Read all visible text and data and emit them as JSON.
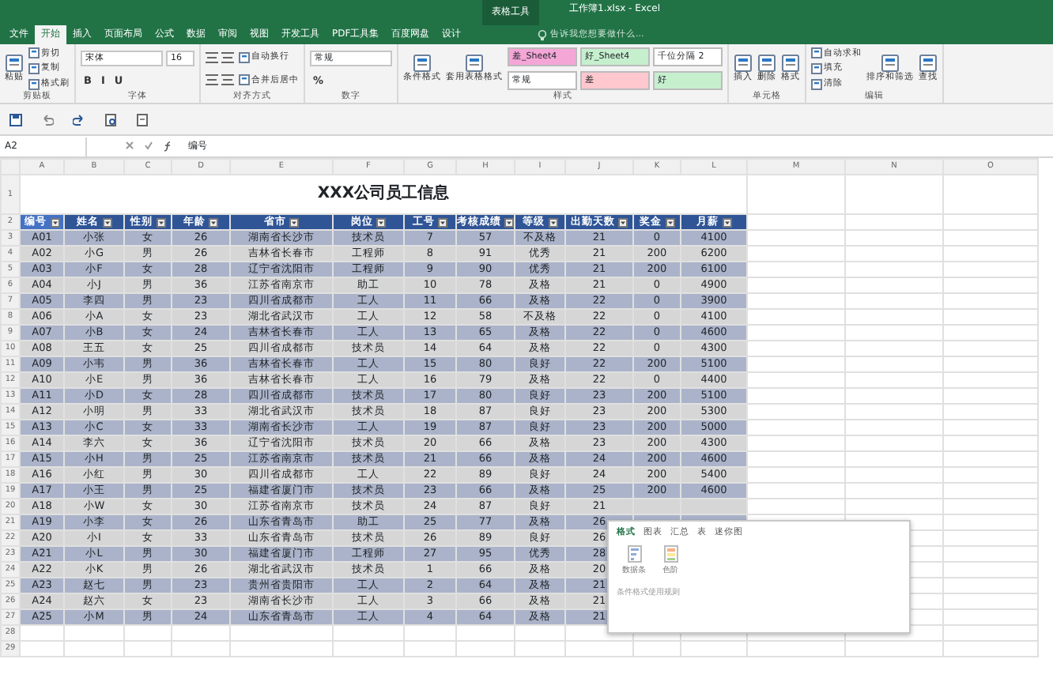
{
  "window": {
    "title": "工作簿1.xlsx - Excel",
    "context_label": "表格工具",
    "tell_me": "告诉我您想要做什么..."
  },
  "tabs": [
    {
      "label": "文件",
      "selected": false
    },
    {
      "label": "开始",
      "selected": true
    },
    {
      "label": "插入",
      "selected": false
    },
    {
      "label": "页面布局",
      "selected": false
    },
    {
      "label": "公式",
      "selected": false
    },
    {
      "label": "数据",
      "selected": false
    },
    {
      "label": "审阅",
      "selected": false
    },
    {
      "label": "视图",
      "selected": false
    },
    {
      "label": "开发工具",
      "selected": false
    },
    {
      "label": "PDF工具集",
      "selected": false
    },
    {
      "label": "百度网盘",
      "selected": false
    },
    {
      "label": "设计",
      "selected": false
    }
  ],
  "ribbon": {
    "groups": [
      {
        "label": "剪贴板",
        "columns": [
          [
            [
              {
                "kind": "big",
                "label": "粘贴"
              }
            ]
          ],
          [
            [
              {
                "kind": "small",
                "label": "剪切"
              }
            ],
            [
              {
                "kind": "small",
                "label": "复制"
              }
            ],
            [
              {
                "kind": "small",
                "label": "格式刷"
              }
            ]
          ]
        ]
      },
      {
        "label": "字体",
        "columns": [
          [
            [
              {
                "kind": "field",
                "label": "宋体"
              },
              {
                "kind": "field",
                "label": "16"
              }
            ],
            [
              {
                "kind": "glyph",
                "label": "B"
              },
              {
                "kind": "glyph",
                "label": "I"
              },
              {
                "kind": "glyph",
                "label": "U"
              }
            ]
          ]
        ]
      },
      {
        "label": "对齐方式",
        "columns": [
          [
            [
              {
                "kind": "align"
              },
              {
                "kind": "align"
              }
            ],
            [
              {
                "kind": "align"
              },
              {
                "kind": "align"
              }
            ]
          ],
          [
            [
              {
                "kind": "small",
                "label": "自动换行"
              }
            ],
            [
              {
                "kind": "small",
                "label": "合并后居中"
              }
            ]
          ]
        ]
      },
      {
        "label": "数字",
        "columns": [
          [
            [
              {
                "kind": "field",
                "label": "常规"
              }
            ],
            [
              {
                "kind": "glyph",
                "label": "%"
              }
            ]
          ]
        ]
      },
      {
        "label": "样式",
        "columns": [
          [
            [
              {
                "kind": "big",
                "label": "条件格式"
              }
            ]
          ],
          [
            [
              {
                "kind": "big",
                "label": "套用表格格式"
              }
            ]
          ],
          [
            [
              {
                "kind": "style",
                "label": "差_Sheet4",
                "color": "#f4a6d7"
              },
              {
                "kind": "style",
                "label": "好_Sheet4",
                "color": "#c6efce"
              },
              {
                "kind": "style",
                "label": "千位分隔 2",
                "color": "#ffffff"
              }
            ],
            [
              {
                "kind": "style",
                "label": "常规",
                "color": "#ffffff"
              },
              {
                "kind": "style",
                "label": "差",
                "color": "#ffc7ce"
              },
              {
                "kind": "style",
                "label": "好",
                "color": "#c6efce"
              }
            ]
          ]
        ]
      },
      {
        "label": "单元格",
        "columns": [
          [
            [
              {
                "kind": "big",
                "label": "插入"
              }
            ]
          ],
          [
            [
              {
                "kind": "big",
                "label": "删除"
              }
            ]
          ],
          [
            [
              {
                "kind": "big",
                "label": "格式"
              }
            ]
          ]
        ]
      },
      {
        "label": "编辑",
        "columns": [
          [
            [
              {
                "kind": "small",
                "label": "自动求和"
              }
            ],
            [
              {
                "kind": "small",
                "label": "填充"
              }
            ],
            [
              {
                "kind": "small",
                "label": "清除"
              }
            ]
          ],
          [
            [
              {
                "kind": "big",
                "label": "排序和筛选"
              }
            ]
          ],
          [
            [
              {
                "kind": "big",
                "label": "查找"
              }
            ]
          ]
        ]
      }
    ]
  },
  "formula_bar": {
    "name_box": "A2",
    "formula": "编号"
  },
  "sheet": {
    "row_numbers": [
      "1",
      "2",
      "3",
      "4",
      "5",
      "6",
      "7",
      "8",
      "9",
      "10",
      "11",
      "12",
      "13",
      "14",
      "15",
      "16",
      "17",
      "18",
      "19",
      "20",
      "21",
      "22",
      "23",
      "24",
      "25",
      "26",
      "27",
      "28",
      "29"
    ],
    "column_letters": [
      "A",
      "B",
      "C",
      "D",
      "E",
      "F",
      "G",
      "H",
      "I",
      "J",
      "K",
      "L",
      "M",
      "N",
      "O"
    ],
    "title": "XXX公司员工信息",
    "columns": [
      "编号",
      "姓名",
      "性别",
      "年龄",
      "省市",
      "岗位",
      "工号",
      "考核成绩",
      "等级",
      "出勤天数",
      "奖金",
      "月薪"
    ],
    "rows": [
      [
        "A01",
        "小张",
        "女",
        "26",
        "湖南省长沙市",
        "技术员",
        "7",
        "57",
        "不及格",
        "21",
        "0",
        "4100"
      ],
      [
        "A02",
        "小G",
        "男",
        "26",
        "吉林省长春市",
        "工程师",
        "8",
        "91",
        "优秀",
        "21",
        "200",
        "6200"
      ],
      [
        "A03",
        "小F",
        "女",
        "28",
        "辽宁省沈阳市",
        "工程师",
        "9",
        "90",
        "优秀",
        "21",
        "200",
        "6100"
      ],
      [
        "A04",
        "小J",
        "男",
        "36",
        "江苏省南京市",
        "助工",
        "10",
        "78",
        "及格",
        "21",
        "0",
        "4900"
      ],
      [
        "A05",
        "李四",
        "男",
        "23",
        "四川省成都市",
        "工人",
        "11",
        "66",
        "及格",
        "22",
        "0",
        "3900"
      ],
      [
        "A06",
        "小A",
        "女",
        "23",
        "湖北省武汉市",
        "工人",
        "12",
        "58",
        "不及格",
        "22",
        "0",
        "4100"
      ],
      [
        "A07",
        "小B",
        "女",
        "24",
        "吉林省长春市",
        "工人",
        "13",
        "65",
        "及格",
        "22",
        "0",
        "4600"
      ],
      [
        "A08",
        "王五",
        "女",
        "25",
        "四川省成都市",
        "技术员",
        "14",
        "64",
        "及格",
        "22",
        "0",
        "4300"
      ],
      [
        "A09",
        "小韦",
        "男",
        "36",
        "吉林省长春市",
        "工人",
        "15",
        "80",
        "良好",
        "22",
        "200",
        "5100"
      ],
      [
        "A10",
        "小E",
        "男",
        "36",
        "吉林省长春市",
        "工人",
        "16",
        "79",
        "及格",
        "22",
        "0",
        "4400"
      ],
      [
        "A11",
        "小D",
        "女",
        "28",
        "四川省成都市",
        "技术员",
        "17",
        "80",
        "良好",
        "23",
        "200",
        "5100"
      ],
      [
        "A12",
        "小明",
        "男",
        "33",
        "湖北省武汉市",
        "技术员",
        "18",
        "87",
        "良好",
        "23",
        "200",
        "5300"
      ],
      [
        "A13",
        "小C",
        "女",
        "33",
        "湖南省长沙市",
        "工人",
        "19",
        "87",
        "良好",
        "23",
        "200",
        "5000"
      ],
      [
        "A14",
        "李六",
        "女",
        "36",
        "辽宁省沈阳市",
        "技术员",
        "20",
        "66",
        "及格",
        "23",
        "200",
        "4300"
      ],
      [
        "A15",
        "小H",
        "男",
        "25",
        "江苏省南京市",
        "技术员",
        "21",
        "66",
        "及格",
        "24",
        "200",
        "4600"
      ],
      [
        "A16",
        "小红",
        "男",
        "30",
        "四川省成都市",
        "工人",
        "22",
        "89",
        "良好",
        "24",
        "200",
        "5400"
      ],
      [
        "A17",
        "小王",
        "男",
        "25",
        "福建省厦门市",
        "技术员",
        "23",
        "66",
        "及格",
        "25",
        "200",
        "4600"
      ],
      [
        "A18",
        "小W",
        "女",
        "30",
        "江苏省南京市",
        "技术员",
        "24",
        "87",
        "良好",
        "21"
      ],
      [
        "A19",
        "小李",
        "女",
        "26",
        "山东省青岛市",
        "助工",
        "25",
        "77",
        "及格",
        "26"
      ],
      [
        "A20",
        "小I",
        "女",
        "33",
        "山东省青岛市",
        "技术员",
        "26",
        "89",
        "良好",
        "26"
      ],
      [
        "A21",
        "小L",
        "男",
        "30",
        "福建省厦门市",
        "工程师",
        "27",
        "95",
        "优秀",
        "28"
      ],
      [
        "A22",
        "小K",
        "男",
        "26",
        "湖北省武汉市",
        "技术员",
        "1",
        "66",
        "及格",
        "20"
      ],
      [
        "A23",
        "赵七",
        "男",
        "23",
        "贵州省贵阳市",
        "工人",
        "2",
        "64",
        "及格",
        "21"
      ],
      [
        "A24",
        "赵六",
        "女",
        "23",
        "湖南省长沙市",
        "工人",
        "3",
        "66",
        "及格",
        "21"
      ],
      [
        "A25",
        "小M",
        "男",
        "24",
        "山东省青岛市",
        "工人",
        "4",
        "64",
        "及格",
        "21"
      ]
    ]
  },
  "quick_analysis": {
    "tabs": [
      {
        "label": "格式",
        "selected": true
      },
      {
        "label": "图表",
        "selected": false
      },
      {
        "label": "汇总",
        "selected": false
      },
      {
        "label": "表",
        "selected": false
      },
      {
        "label": "迷你图",
        "selected": false
      }
    ],
    "items": [
      {
        "label": "数据条"
      },
      {
        "label": "色阶"
      }
    ],
    "footer": "条件格式使用规则"
  }
}
